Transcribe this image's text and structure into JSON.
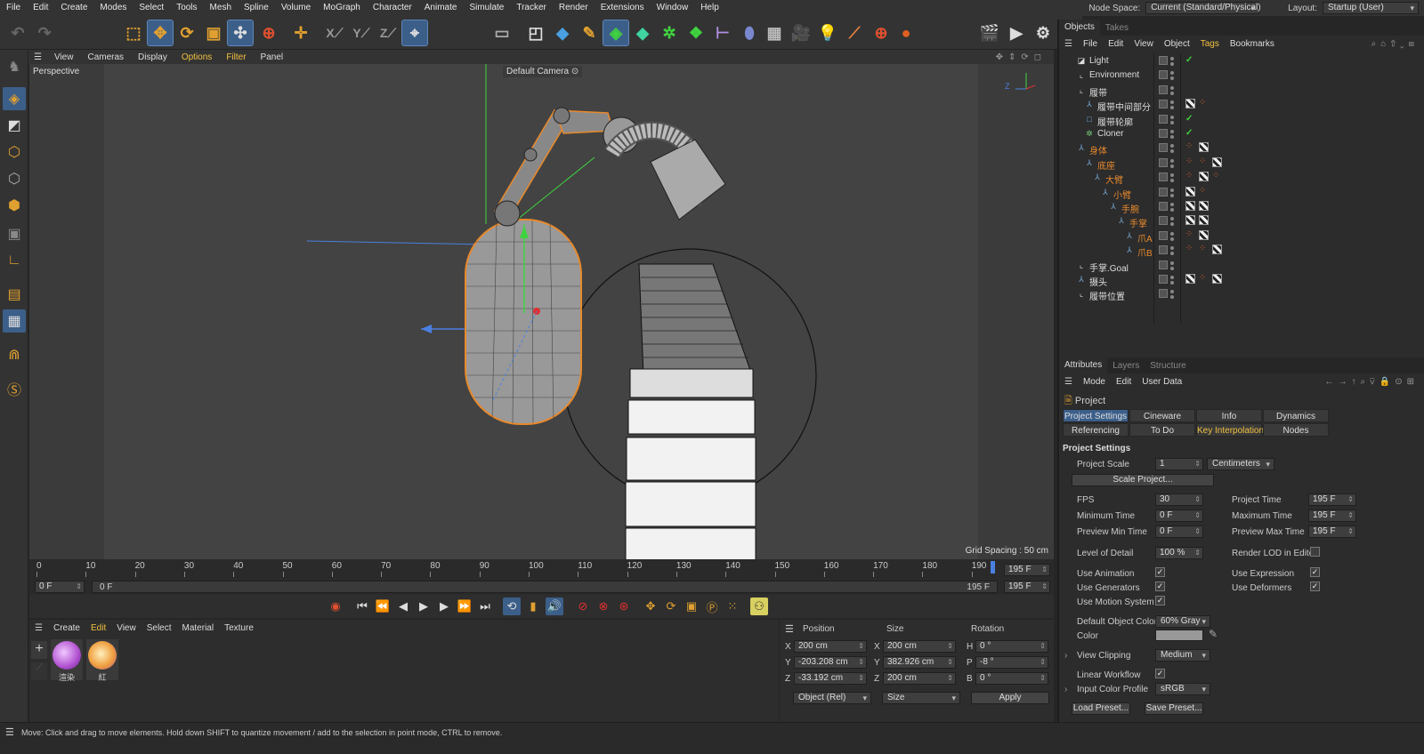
{
  "menubar": {
    "items": [
      "File",
      "Edit",
      "Create",
      "Modes",
      "Select",
      "Tools",
      "Mesh",
      "Spline",
      "Volume",
      "MoGraph",
      "Character",
      "Animate",
      "Simulate",
      "Tracker",
      "Render",
      "Extensions",
      "Window",
      "Help"
    ],
    "node_space_label": "Node Space:",
    "node_space_value": "Current (Standard/Physical)",
    "layout_label": "Layout:",
    "layout_value": "Startup (User)"
  },
  "viewport": {
    "menu": [
      "View",
      "Cameras",
      "Display",
      "Options",
      "Filter",
      "Panel"
    ],
    "name": "Perspective",
    "camera": "Default Camera",
    "grid_spacing": "Grid Spacing : 50 cm",
    "axis_z": "Z"
  },
  "timeline": {
    "ticks": [
      "0",
      "10",
      "20",
      "30",
      "40",
      "50",
      "60",
      "70",
      "80",
      "90",
      "100",
      "110",
      "120",
      "130",
      "140",
      "150",
      "160",
      "170",
      "180",
      "190"
    ],
    "end_frame": "195 F",
    "start_field": "0 F",
    "range_start": "0 F",
    "range_end": "195 F",
    "end_field": "195 F"
  },
  "material_panel": {
    "menu": [
      "Create",
      "Edit",
      "View",
      "Select",
      "Material",
      "Texture"
    ],
    "materials": [
      {
        "name": "渲染"
      },
      {
        "name": "紅"
      }
    ]
  },
  "coordinates": {
    "headers": [
      "Position",
      "Size",
      "Rotation"
    ],
    "rows": [
      {
        "pos_axis": "X",
        "pos": "200 cm",
        "size_axis": "X",
        "size": "200 cm",
        "rot_axis": "H",
        "rot": "0 °"
      },
      {
        "pos_axis": "Y",
        "pos": "-203.208 cm",
        "size_axis": "Y",
        "size": "382.926 cm",
        "rot_axis": "P",
        "rot": "-8 °"
      },
      {
        "pos_axis": "Z",
        "pos": "-33.192 cm",
        "size_axis": "Z",
        "size": "200 cm",
        "rot_axis": "B",
        "rot": "0 °"
      }
    ],
    "mode_select": "Object (Rel)",
    "size_select": "Size",
    "apply": "Apply"
  },
  "status": "Move: Click and drag to move elements. Hold down SHIFT to quantize movement / add to the selection in point mode, CTRL to remove.",
  "objects_panel": {
    "tabs": [
      "Objects",
      "Takes"
    ],
    "menu": [
      "File",
      "Edit",
      "View",
      "Object",
      "Tags",
      "Bookmarks"
    ],
    "items": [
      {
        "name": "Light",
        "indent": 0,
        "icon": "light-icon",
        "highlight": false
      },
      {
        "name": "Environment",
        "indent": 0,
        "icon": "null-icon",
        "highlight": false
      },
      {
        "name": "履带",
        "indent": 0,
        "icon": "null-icon",
        "highlight": false
      },
      {
        "name": "履带中间部分",
        "indent": 1,
        "icon": "joint-icon",
        "highlight": false
      },
      {
        "name": "履带轮廓",
        "indent": 1,
        "icon": "spline-icon",
        "highlight": false
      },
      {
        "name": "Cloner",
        "indent": 1,
        "icon": "cloner-icon",
        "highlight": false
      },
      {
        "name": "身体",
        "indent": 0,
        "icon": "joint-icon",
        "highlight": true
      },
      {
        "name": "底座",
        "indent": 1,
        "icon": "joint-icon",
        "highlight": true
      },
      {
        "name": "大臂",
        "indent": 2,
        "icon": "joint-icon",
        "highlight": true
      },
      {
        "name": "小臂",
        "indent": 3,
        "icon": "joint-icon",
        "highlight": true
      },
      {
        "name": "手腕",
        "indent": 4,
        "icon": "joint-icon",
        "highlight": true
      },
      {
        "name": "手掌",
        "indent": 5,
        "icon": "joint-icon",
        "highlight": true
      },
      {
        "name": "爪A",
        "indent": 6,
        "icon": "joint-icon",
        "highlight": true
      },
      {
        "name": "爪B",
        "indent": 6,
        "icon": "joint-icon",
        "highlight": true
      },
      {
        "name": "手掌.Goal",
        "indent": 0,
        "icon": "null-icon",
        "highlight": false
      },
      {
        "name": "摄头",
        "indent": 0,
        "icon": "joint-icon",
        "highlight": false
      },
      {
        "name": "履带位置",
        "indent": 0,
        "icon": "null-icon",
        "highlight": false
      }
    ]
  },
  "attributes_panel": {
    "tabs": [
      "Attributes",
      "Layers",
      "Structure"
    ],
    "menu": [
      "Mode",
      "Edit",
      "User Data"
    ],
    "title": "Project",
    "tabs_row1": [
      "Project Settings",
      "Cineware",
      "Info",
      "Dynamics"
    ],
    "tabs_row2": [
      "Referencing",
      "To Do",
      "Key Interpolation",
      "Nodes"
    ],
    "section": "Project Settings",
    "project_scale_label": "Project Scale",
    "project_scale_value": "1",
    "project_scale_unit": "Centimeters",
    "scale_project_button": "Scale Project...",
    "fps_label": "FPS",
    "fps_value": "30",
    "project_time_label": "Project Time",
    "project_time_value": "195 F",
    "min_time_label": "Minimum Time",
    "min_time_value": "0 F",
    "max_time_label": "Maximum Time",
    "max_time_value": "195 F",
    "preview_min_label": "Preview Min Time",
    "preview_min_value": "0 F",
    "preview_max_label": "Preview Max Time",
    "preview_max_value": "195 F",
    "lod_label": "Level of Detail",
    "lod_value": "100 %",
    "render_lod_label": "Render LOD in Editor",
    "use_animation_label": "Use Animation",
    "use_expression_label": "Use Expression",
    "use_generators_label": "Use Generators",
    "use_deformers_label": "Use Deformers",
    "use_motion_label": "Use Motion System",
    "default_color_label": "Default Object Color",
    "default_color_value": "60% Gray",
    "color_label": "Color",
    "view_clipping_label": "View Clipping",
    "view_clipping_value": "Medium",
    "linear_workflow_label": "Linear Workflow",
    "input_profile_label": "Input Color Profile",
    "input_profile_value": "sRGB",
    "load_preset": "Load Preset...",
    "save_preset": "Save Preset..."
  },
  "colors": {
    "accent": "#3c5f8a",
    "highlight": "#e8892c",
    "menu_accent": "#f0c040"
  }
}
